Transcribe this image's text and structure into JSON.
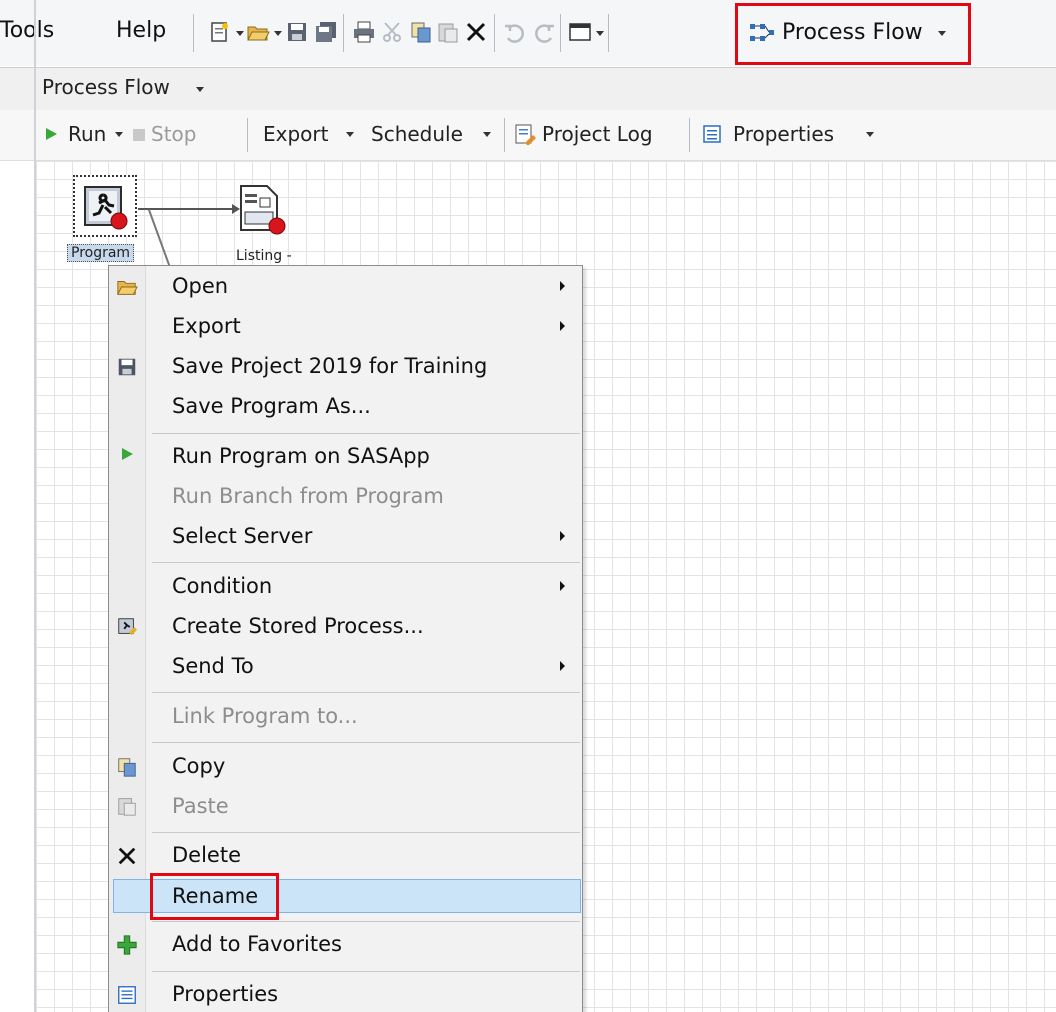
{
  "menubar": {
    "items": [
      "Tools",
      "Help"
    ],
    "process_flow_label": "Process Flow"
  },
  "process_flow_bar": {
    "label": "Process Flow"
  },
  "run_toolbar": {
    "run": "Run",
    "stop": "Stop",
    "export": "Export",
    "schedule": "Schedule",
    "project_log": "Project Log",
    "properties": "Properties"
  },
  "nodes": {
    "program": "Program",
    "listing": "Listing -"
  },
  "context_menu": {
    "items": [
      {
        "label": "Open",
        "submenu": true,
        "icon": "folder-open-icon"
      },
      {
        "label": "Export",
        "submenu": true
      },
      {
        "label": "Save Project 2019 for Training",
        "icon": "save-icon"
      },
      {
        "label": "Save Program As..."
      },
      {
        "label": "Run Program on SASApp",
        "icon": "run-icon"
      },
      {
        "label": "Run Branch from Program",
        "disabled": true
      },
      {
        "label": "Select Server",
        "submenu": true
      },
      {
        "label": "Condition",
        "submenu": true
      },
      {
        "label": "Create Stored Process...",
        "icon": "stored-process-icon"
      },
      {
        "label": "Send To",
        "submenu": true
      },
      {
        "label": "Link Program to...",
        "disabled": true
      },
      {
        "label": "Copy",
        "icon": "copy-icon"
      },
      {
        "label": "Paste",
        "icon": "paste-icon",
        "disabled": true
      },
      {
        "label": "Delete",
        "icon": "delete-icon"
      },
      {
        "label": "Rename",
        "highlighted": true
      },
      {
        "label": "Add to Favorites",
        "icon": "add-favorites-icon"
      },
      {
        "label": "Properties",
        "icon": "properties-icon"
      }
    ]
  },
  "colors": {
    "highlight_red": "#e30613",
    "selection_blue": "#cce4f7",
    "run_green": "#3aa73a"
  }
}
